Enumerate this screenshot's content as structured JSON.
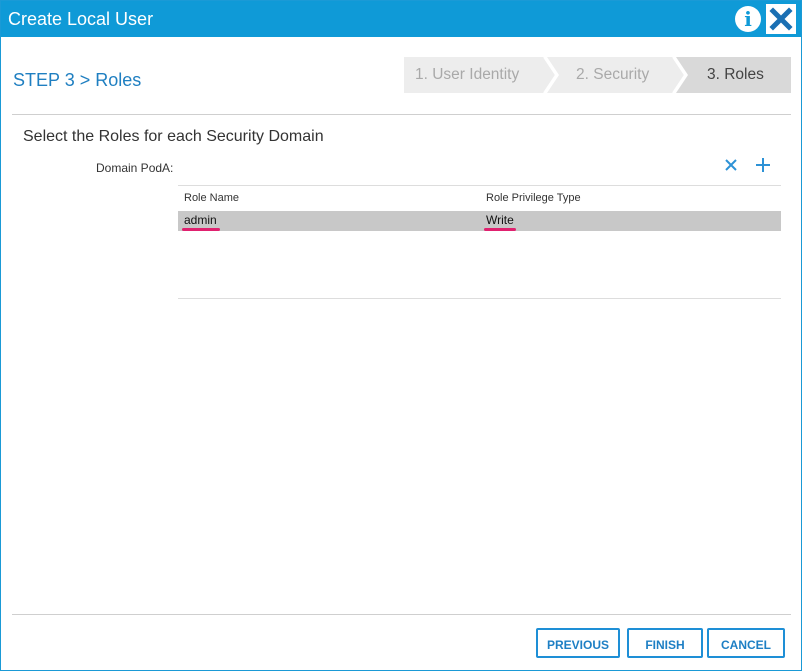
{
  "dialog": {
    "title": "Create Local User",
    "info_icon": "info-icon",
    "close_icon": "close-icon"
  },
  "step": {
    "label": "STEP 3 > Roles"
  },
  "wizard": {
    "steps": [
      {
        "label": "1. User Identity",
        "active": false
      },
      {
        "label": "2. Security",
        "active": false
      },
      {
        "label": "3. Roles",
        "active": true
      }
    ]
  },
  "content": {
    "section_title": "Select the Roles for each Security Domain",
    "domain_label": "Domain PodA:",
    "delete_icon": "delete-icon",
    "add_icon": "add-icon"
  },
  "table": {
    "columns": [
      "Role Name",
      "Role Privilege Type"
    ],
    "rows": [
      {
        "role_name": "admin",
        "privilege_type": "Write",
        "selected": true
      }
    ]
  },
  "footer": {
    "previous_label": "PREVIOUS",
    "finish_label": "FINISH",
    "cancel_label": "CANCEL"
  },
  "colors": {
    "titlebar": "#0f9ad7",
    "accent": "#1f7fc1",
    "selected_row": "#c8c8c8",
    "annotation_underline": "#e0216f"
  }
}
